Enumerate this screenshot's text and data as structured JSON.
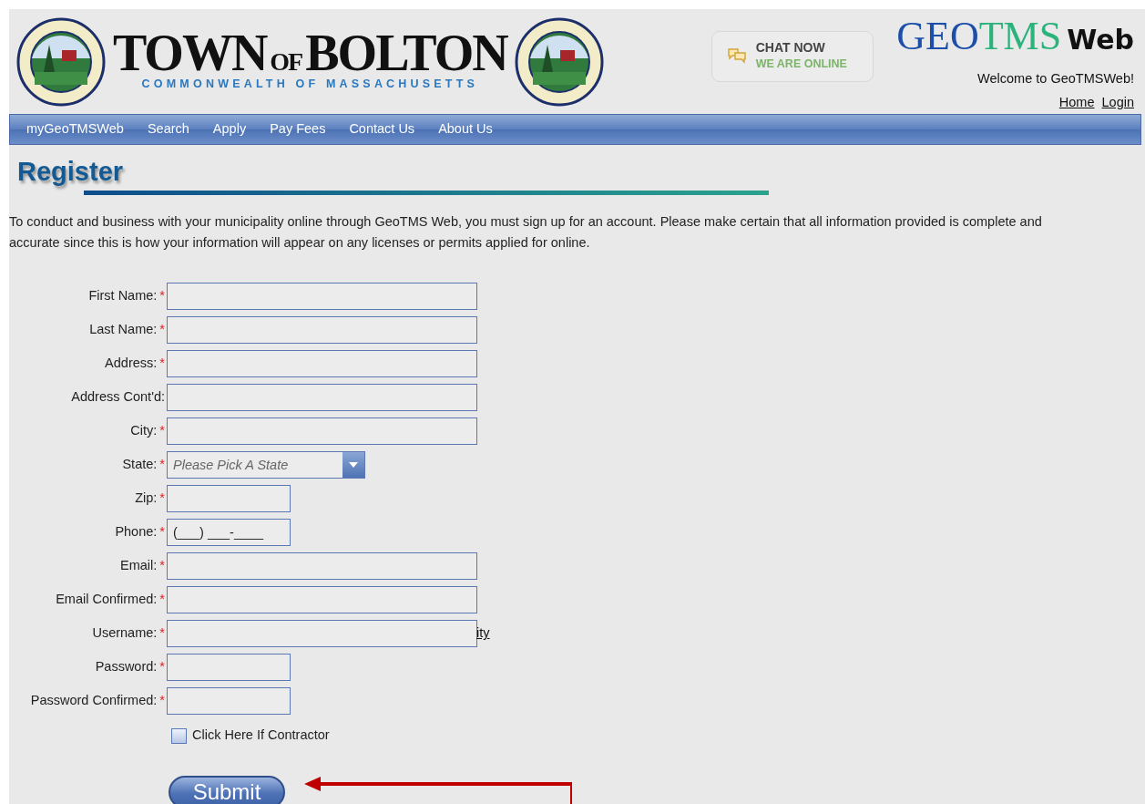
{
  "header": {
    "logo": {
      "word_1": "TOWN",
      "word_2": "OF",
      "word_3": "BOLTON",
      "subtitle": "COMMONWEALTH OF MASSACHUSETTS"
    },
    "chat": {
      "title": "CHAT NOW",
      "status": "WE ARE ONLINE"
    },
    "brand": {
      "part_1": "GEO",
      "part_2": "TMS",
      "part_3": "Web"
    },
    "welcome": "Welcome to GeoTMSWeb!",
    "links": [
      "Home",
      "Login"
    ]
  },
  "nav": [
    "myGeoTMSWeb",
    "Search",
    "Apply",
    "Pay Fees",
    "Contact Us",
    "About Us"
  ],
  "page_title": "Register",
  "intro": "To conduct and business with your municipality online through GeoTMS Web, you must sign up for an account. Please make certain that all information provided is complete and accurate since this is how your information will appear on any licenses or permits applied for online.",
  "form": {
    "fields": [
      {
        "label": "First Name:",
        "required_mark": "*",
        "kind": "text"
      },
      {
        "label": "Last Name:",
        "required_mark": "*",
        "kind": "text"
      },
      {
        "label": "Address:",
        "required_mark": "*",
        "kind": "text"
      },
      {
        "label": "Address Cont'd:",
        "kind": "text"
      },
      {
        "label": "City:",
        "required_mark": "*",
        "kind": "text"
      },
      {
        "label": "State:",
        "required_mark": "*",
        "kind": "select",
        "placeholder": "Please Pick A State"
      },
      {
        "label": "Zip:",
        "required_mark": "*",
        "kind": "short"
      },
      {
        "label": "Phone:",
        "required_mark": "*",
        "kind": "short",
        "value": "(___) ___-____"
      },
      {
        "label": "Email:",
        "required_mark": "*",
        "kind": "text"
      },
      {
        "label": "Email Confirmed:",
        "required_mark": "*",
        "kind": "text"
      },
      {
        "label": "Username:",
        "required_mark": "*",
        "kind": "text",
        "trailing_link": "ity"
      },
      {
        "label": "Password:",
        "required_mark": "*",
        "kind": "short"
      },
      {
        "label": "Password Confirmed:",
        "required_mark": "*",
        "kind": "short"
      }
    ],
    "contractor": {
      "label": "Click Here If Contractor",
      "checked": false
    },
    "submit": "Submit"
  }
}
